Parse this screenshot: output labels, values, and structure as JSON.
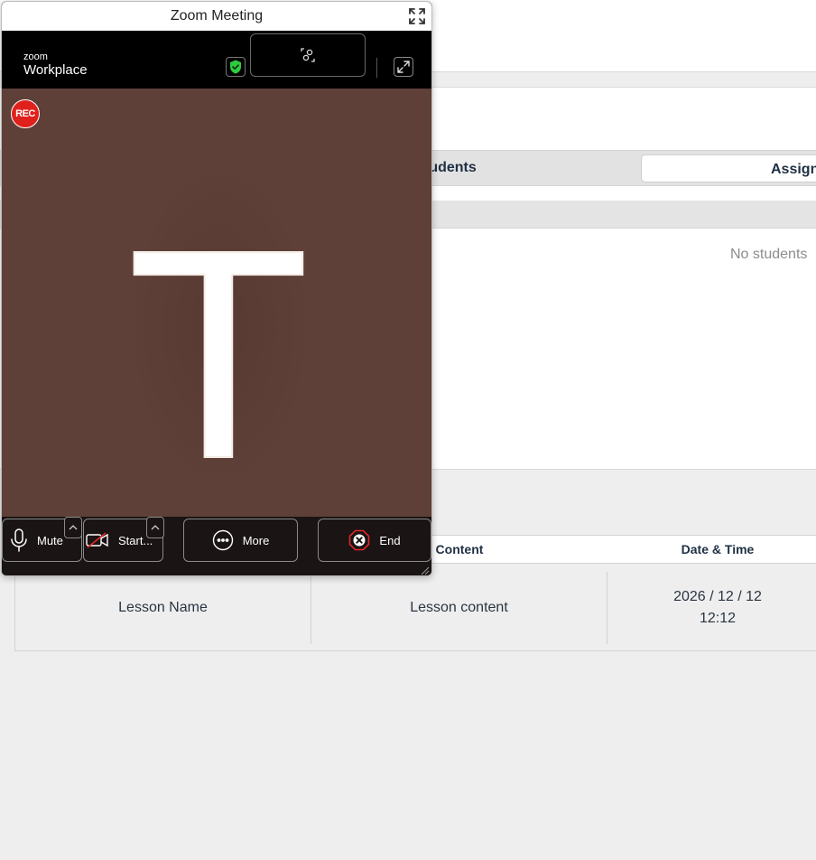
{
  "zoom": {
    "window_title": "Zoom Meeting",
    "brand_small": "zoom",
    "brand_big": "Workplace",
    "rec_badge": "REC",
    "avatar_initial": "T",
    "controls": {
      "mute_label": "Mute",
      "video_label": "Start...",
      "more_label": "More",
      "end_label": "End"
    },
    "colors": {
      "video_bg": "#5e4038",
      "rec_red": "#e0201b",
      "end_red": "#e02828",
      "shield_green": "#2ecc40"
    }
  },
  "app": {
    "tabs": {
      "students_label": "tudents",
      "assign_label": "Assign"
    },
    "students_empty_text": "No students",
    "lessons_table": {
      "headers": {
        "content": "Content",
        "date_time": "Date & Time"
      },
      "rows": [
        {
          "name": "Lesson Name",
          "content": "Lesson content",
          "date": "2026 / 12 / 12",
          "time": "12:12"
        }
      ]
    }
  }
}
